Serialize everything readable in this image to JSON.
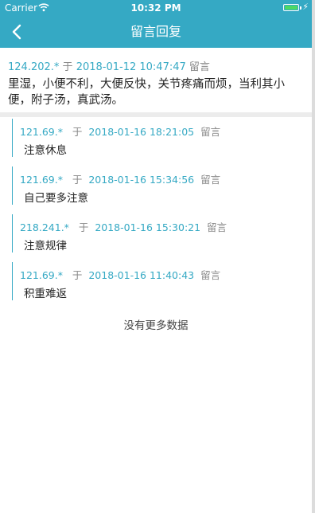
{
  "status_bar": {
    "carrier": "Carrier",
    "time": "10:32 PM",
    "battery_level": 1.0
  },
  "nav": {
    "back_icon": "chevron-left-icon",
    "title": "留言回复"
  },
  "message": {
    "ip": "124.202.*",
    "sep": "于",
    "time": "2018-01-12 10:47:47",
    "tag": "留言",
    "content": "里湿，小便不利，大便反快，关节疼痛而烦，当利其小便，附子汤，真武汤。"
  },
  "replies": [
    {
      "ip": "121.69.*",
      "sep": "于",
      "time": "2018-01-16 18:21:05",
      "tag": "留言",
      "content": "注意休息"
    },
    {
      "ip": "121.69.*",
      "sep": "于",
      "time": "2018-01-16 15:34:56",
      "tag": "留言",
      "content": "自己要多注意"
    },
    {
      "ip": "218.241.*",
      "sep": "于",
      "time": "2018-01-16 15:30:21",
      "tag": "留言",
      "content": "注意规律"
    },
    {
      "ip": "121.69.*",
      "sep": "于",
      "time": "2018-01-16 11:40:43",
      "tag": "留言",
      "content": "积重难返"
    }
  ],
  "footer": {
    "no_more": "没有更多数据"
  },
  "colors": {
    "accent": "#35a9c4",
    "divider": "#ececec"
  }
}
